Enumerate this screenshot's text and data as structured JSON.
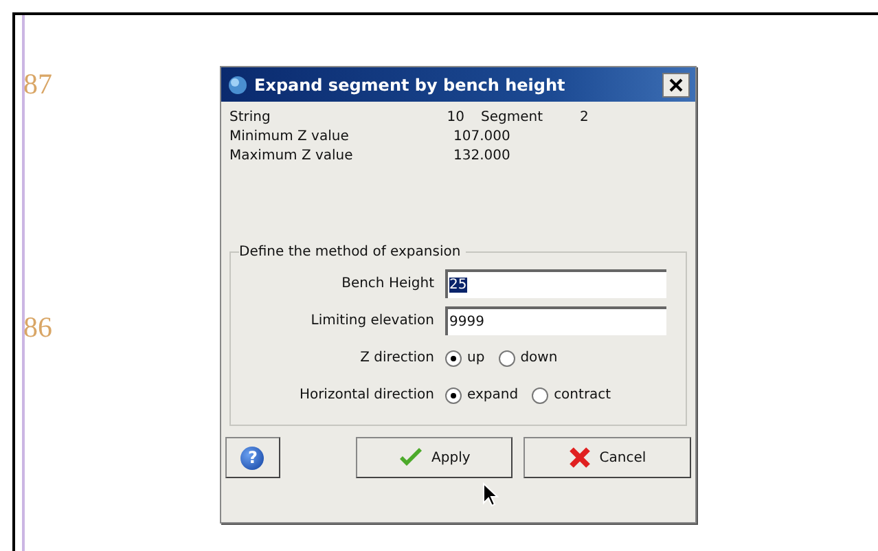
{
  "page": {
    "row_labels": [
      "87",
      "86"
    ]
  },
  "dialog": {
    "title": "Expand segment by bench height",
    "info": [
      {
        "label": "String",
        "value": "10",
        "extra_label": "Segment",
        "extra_value": "2"
      },
      {
        "label": "Minimum Z value",
        "value": "107.000"
      },
      {
        "label": "Maximum Z value",
        "value": "132.000"
      }
    ],
    "group": {
      "title": "Define the method of expansion",
      "fields": [
        {
          "kind": "input",
          "label": "Bench Height",
          "value": "25",
          "highlighted": true
        },
        {
          "kind": "input",
          "label": "Limiting elevation",
          "value": "9999",
          "highlighted": false
        },
        {
          "kind": "radio",
          "label": "Z direction",
          "options": [
            {
              "label": "up",
              "selected": true
            },
            {
              "label": "down",
              "selected": false
            }
          ]
        },
        {
          "kind": "radio",
          "label": "Horizontal direction",
          "options": [
            {
              "label": "expand",
              "selected": true
            },
            {
              "label": "contract",
              "selected": false
            }
          ]
        }
      ]
    },
    "buttons": [
      {
        "kind": "help",
        "label": "?"
      },
      {
        "kind": "apply",
        "label": "Apply"
      },
      {
        "kind": "cancel",
        "label": "Cancel"
      }
    ]
  }
}
